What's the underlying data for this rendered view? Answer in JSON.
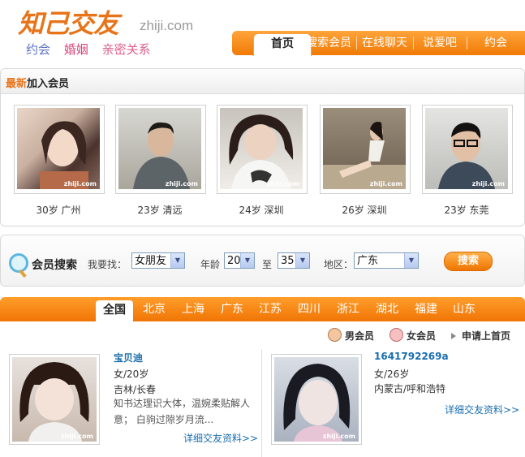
{
  "header": {
    "logo_text": "知己交友",
    "logo_domain": "zhiji.com",
    "tags": [
      "约会",
      "婚姻",
      "亲密关系"
    ]
  },
  "nav": {
    "items": [
      "首页",
      "搜索会员",
      "在线聊天",
      "说爱吧",
      "约会"
    ]
  },
  "new_members": {
    "title_highlight": "最新",
    "title_rest": "加入会员",
    "members": [
      {
        "caption": "30岁  广州"
      },
      {
        "caption": "23岁  清远"
      },
      {
        "caption": "24岁  深圳"
      },
      {
        "caption": "26岁  深圳"
      },
      {
        "caption": "23岁  东莞"
      }
    ],
    "watermark": "zhiji.com"
  },
  "search": {
    "title": "会员搜索",
    "looking_label": "我要找：",
    "looking_value": "女朋友",
    "age_label": "年龄",
    "age_from": "20",
    "age_to_label": "至",
    "age_to": "35",
    "region_label": "地区：",
    "region_value": "广东",
    "button_label": "搜索"
  },
  "regions": {
    "items": [
      "全国",
      "北京",
      "上海",
      "广东",
      "江苏",
      "四川",
      "浙江",
      "湖北",
      "福建",
      "山东"
    ]
  },
  "legend": {
    "male": "男会员",
    "female": "女会员",
    "apply": "申请上首页"
  },
  "cards": [
    {
      "name": "宝贝迪",
      "gender_age": "女/20岁",
      "location": "吉林/长春",
      "desc": "知书达理识大体，温婉柔贴解人意； 白驹过隙岁月流...",
      "link": "详细交友资料>>"
    },
    {
      "name": "1641792269a",
      "gender_age": "女/26岁",
      "location": "内蒙古/呼和浩特",
      "desc": "",
      "link": "详细交友资料>>"
    }
  ],
  "colors": {
    "brand_orange": "#f07a05",
    "link_blue": "#1a6eb0",
    "logo_orange": "#e8741a"
  }
}
